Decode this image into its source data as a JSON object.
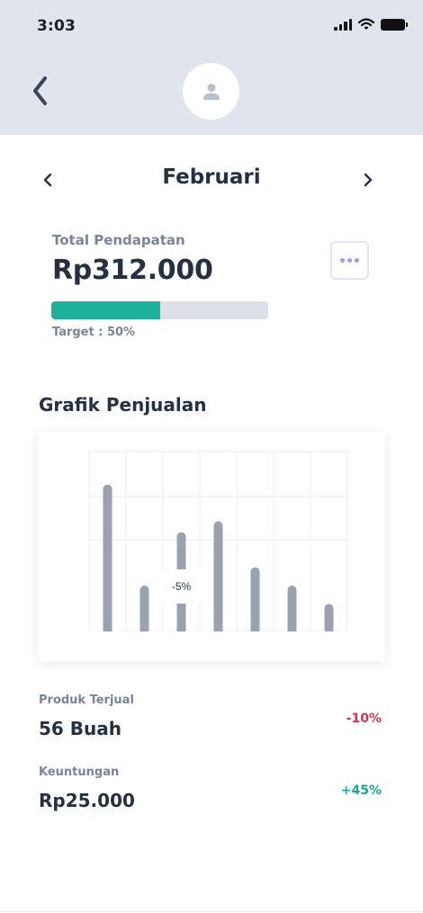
{
  "status_bar": {
    "time": "3:03"
  },
  "icons": {
    "back": "chevron-left-icon",
    "avatar": "user-icon",
    "prev": "chevron-left-icon",
    "next": "chevron-right-icon",
    "more": "ellipsis-icon"
  },
  "month": {
    "label": "Februari"
  },
  "income": {
    "label": "Total Pendapatan",
    "value": "Rp312.000",
    "target_label": "Target : 50%",
    "progress": 0.5
  },
  "chart_section": {
    "title": "Grafik Penjualan"
  },
  "chart_data": {
    "type": "bar",
    "categories": [
      "",
      "",
      "",
      "",
      "",
      "",
      ""
    ],
    "values": [
      80,
      25,
      54,
      60,
      35,
      25,
      15
    ],
    "ylim": [
      0,
      98
    ],
    "grid": true,
    "tooltip": {
      "index": 2,
      "text": "-5%"
    }
  },
  "stats": [
    {
      "label": "Produk Terjual",
      "value": "56 Buah",
      "change": "-10%",
      "trend": "down"
    },
    {
      "label": "Keuntungan",
      "value": "Rp25.000",
      "change": "+45%",
      "trend": "up"
    }
  ],
  "colors": {
    "header_bg": "#dfe4ed",
    "progress_fill": "#1db19c",
    "progress_track": "#dce0e7",
    "bar": "#9aa2af",
    "negative": "#d8344e",
    "positive": "#1aa88c",
    "accent": "#9d9cf2"
  }
}
